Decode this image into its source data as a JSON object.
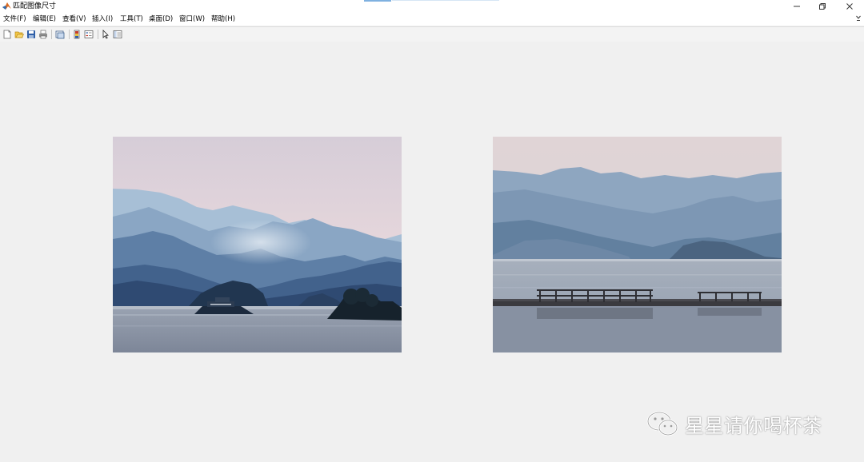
{
  "window": {
    "title": "匹配图像尺寸",
    "controls": [
      "minimize",
      "restore",
      "close"
    ]
  },
  "menu": {
    "items": [
      {
        "label": "文件(F)"
      },
      {
        "label": "编辑(E)"
      },
      {
        "label": "查看(V)"
      },
      {
        "label": "插入(I)"
      },
      {
        "label": "工具(T)"
      },
      {
        "label": "桌面(D)"
      },
      {
        "label": "窗口(W)"
      },
      {
        "label": "帮助(H)"
      }
    ]
  },
  "toolbar": {
    "buttons": [
      {
        "name": "new-figure",
        "icon": "new-file-icon"
      },
      {
        "name": "open-file",
        "icon": "folder-open-icon"
      },
      {
        "name": "save-figure",
        "icon": "save-disk-icon"
      },
      {
        "name": "print-figure",
        "icon": "printer-icon"
      },
      {
        "name": "link-plot",
        "icon": "link-plot-icon"
      },
      {
        "name": "insert-colorbar",
        "icon": "colorbar-icon"
      },
      {
        "name": "insert-legend",
        "icon": "legend-icon"
      },
      {
        "name": "edit-plot",
        "icon": "pointer-arrow-icon"
      },
      {
        "name": "property-inspector",
        "icon": "property-inspector-icon"
      }
    ]
  },
  "figures": {
    "left_image": {
      "subject": "misty mountains over lake with ferry boat"
    },
    "right_image": {
      "subject": "misty mountains over lake with wooden pier"
    }
  },
  "watermark": {
    "text": "星星请你喝杯茶",
    "icon": "wechat-icon"
  },
  "colors": {
    "window_bg": "#f0f0f0",
    "titlebar_bg": "#ffffff",
    "accent": "#7fb1e0"
  }
}
